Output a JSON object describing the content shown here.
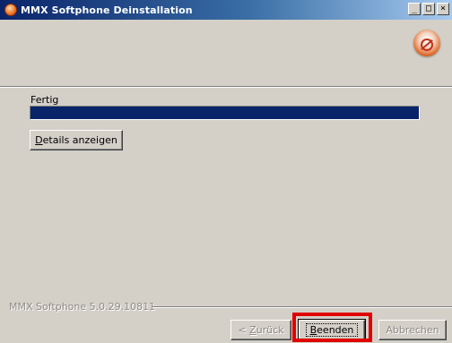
{
  "window": {
    "title": "MMX Softphone Deinstallation",
    "minimize": "_",
    "maximize": "□",
    "close": "×"
  },
  "status": {
    "label": "Fertig",
    "progress_percent": 100
  },
  "details_button": {
    "mnemonic": "D",
    "rest": "etails anzeigen"
  },
  "version_text": "MMX Softphone 5.0.29.10811",
  "footer": {
    "back": {
      "prefix": "< ",
      "mnemonic": "Z",
      "rest": "urück",
      "enabled": false
    },
    "finish": {
      "mnemonic": "B",
      "rest": "eenden",
      "enabled": true
    },
    "cancel": {
      "label": "Abbrechen",
      "enabled": false
    }
  },
  "colors": {
    "titlebar_start": "#0a246a",
    "titlebar_end": "#a6caf0",
    "progress_fill": "#0a246a",
    "highlight": "#e00000",
    "window_bg": "#d4d0c8"
  }
}
